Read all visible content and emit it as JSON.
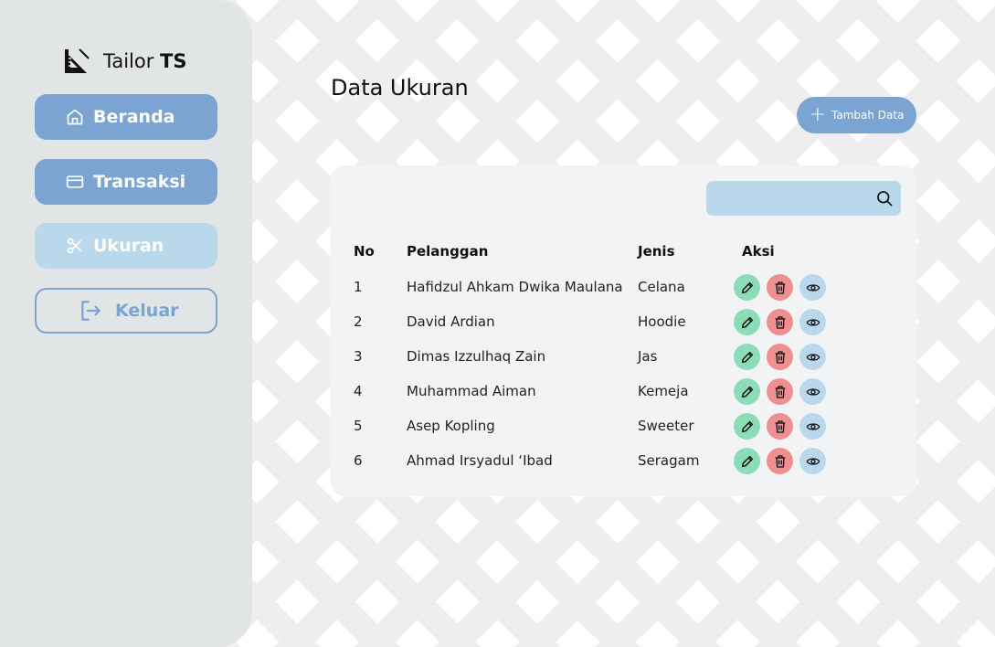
{
  "app": {
    "brand_prefix": "Tailor ",
    "brand_bold": "TS",
    "accent": "#7ba4d3",
    "active_bg": "#b9d8ec"
  },
  "sidebar": {
    "items": [
      {
        "label": "Beranda",
        "icon": "home-icon"
      },
      {
        "label": "Transaksi",
        "icon": "card-icon"
      },
      {
        "label": "Ukuran",
        "icon": "scissors-icon",
        "active": true
      },
      {
        "label": "Keluar",
        "icon": "logout-icon"
      }
    ]
  },
  "main": {
    "title": "Data Ukuran",
    "add_label": "Tambah Data",
    "search_placeholder": "",
    "columns": [
      "No",
      "Pelanggan",
      "Jenis",
      "Aksi"
    ],
    "rows": [
      {
        "no": "1",
        "pelanggan": "Hafidzul Ahkam Dwika Maulana",
        "jenis": "Celana"
      },
      {
        "no": "2",
        "pelanggan": "David Ardian",
        "jenis": "Hoodie"
      },
      {
        "no": "3",
        "pelanggan": "Dimas Izzulhaq Zain",
        "jenis": "Jas"
      },
      {
        "no": "4",
        "pelanggan": "Muhammad Aiman",
        "jenis": "Kemeja"
      },
      {
        "no": "5",
        "pelanggan": "Asep Kopling",
        "jenis": "Sweeter"
      },
      {
        "no": "6",
        "pelanggan": "Ahmad Irsyadul ‘Ibad",
        "jenis": "Seragam"
      }
    ],
    "action_colors": {
      "edit": "#8cdcb8",
      "delete": "#f08f90",
      "view": "#b9d8ec"
    }
  }
}
